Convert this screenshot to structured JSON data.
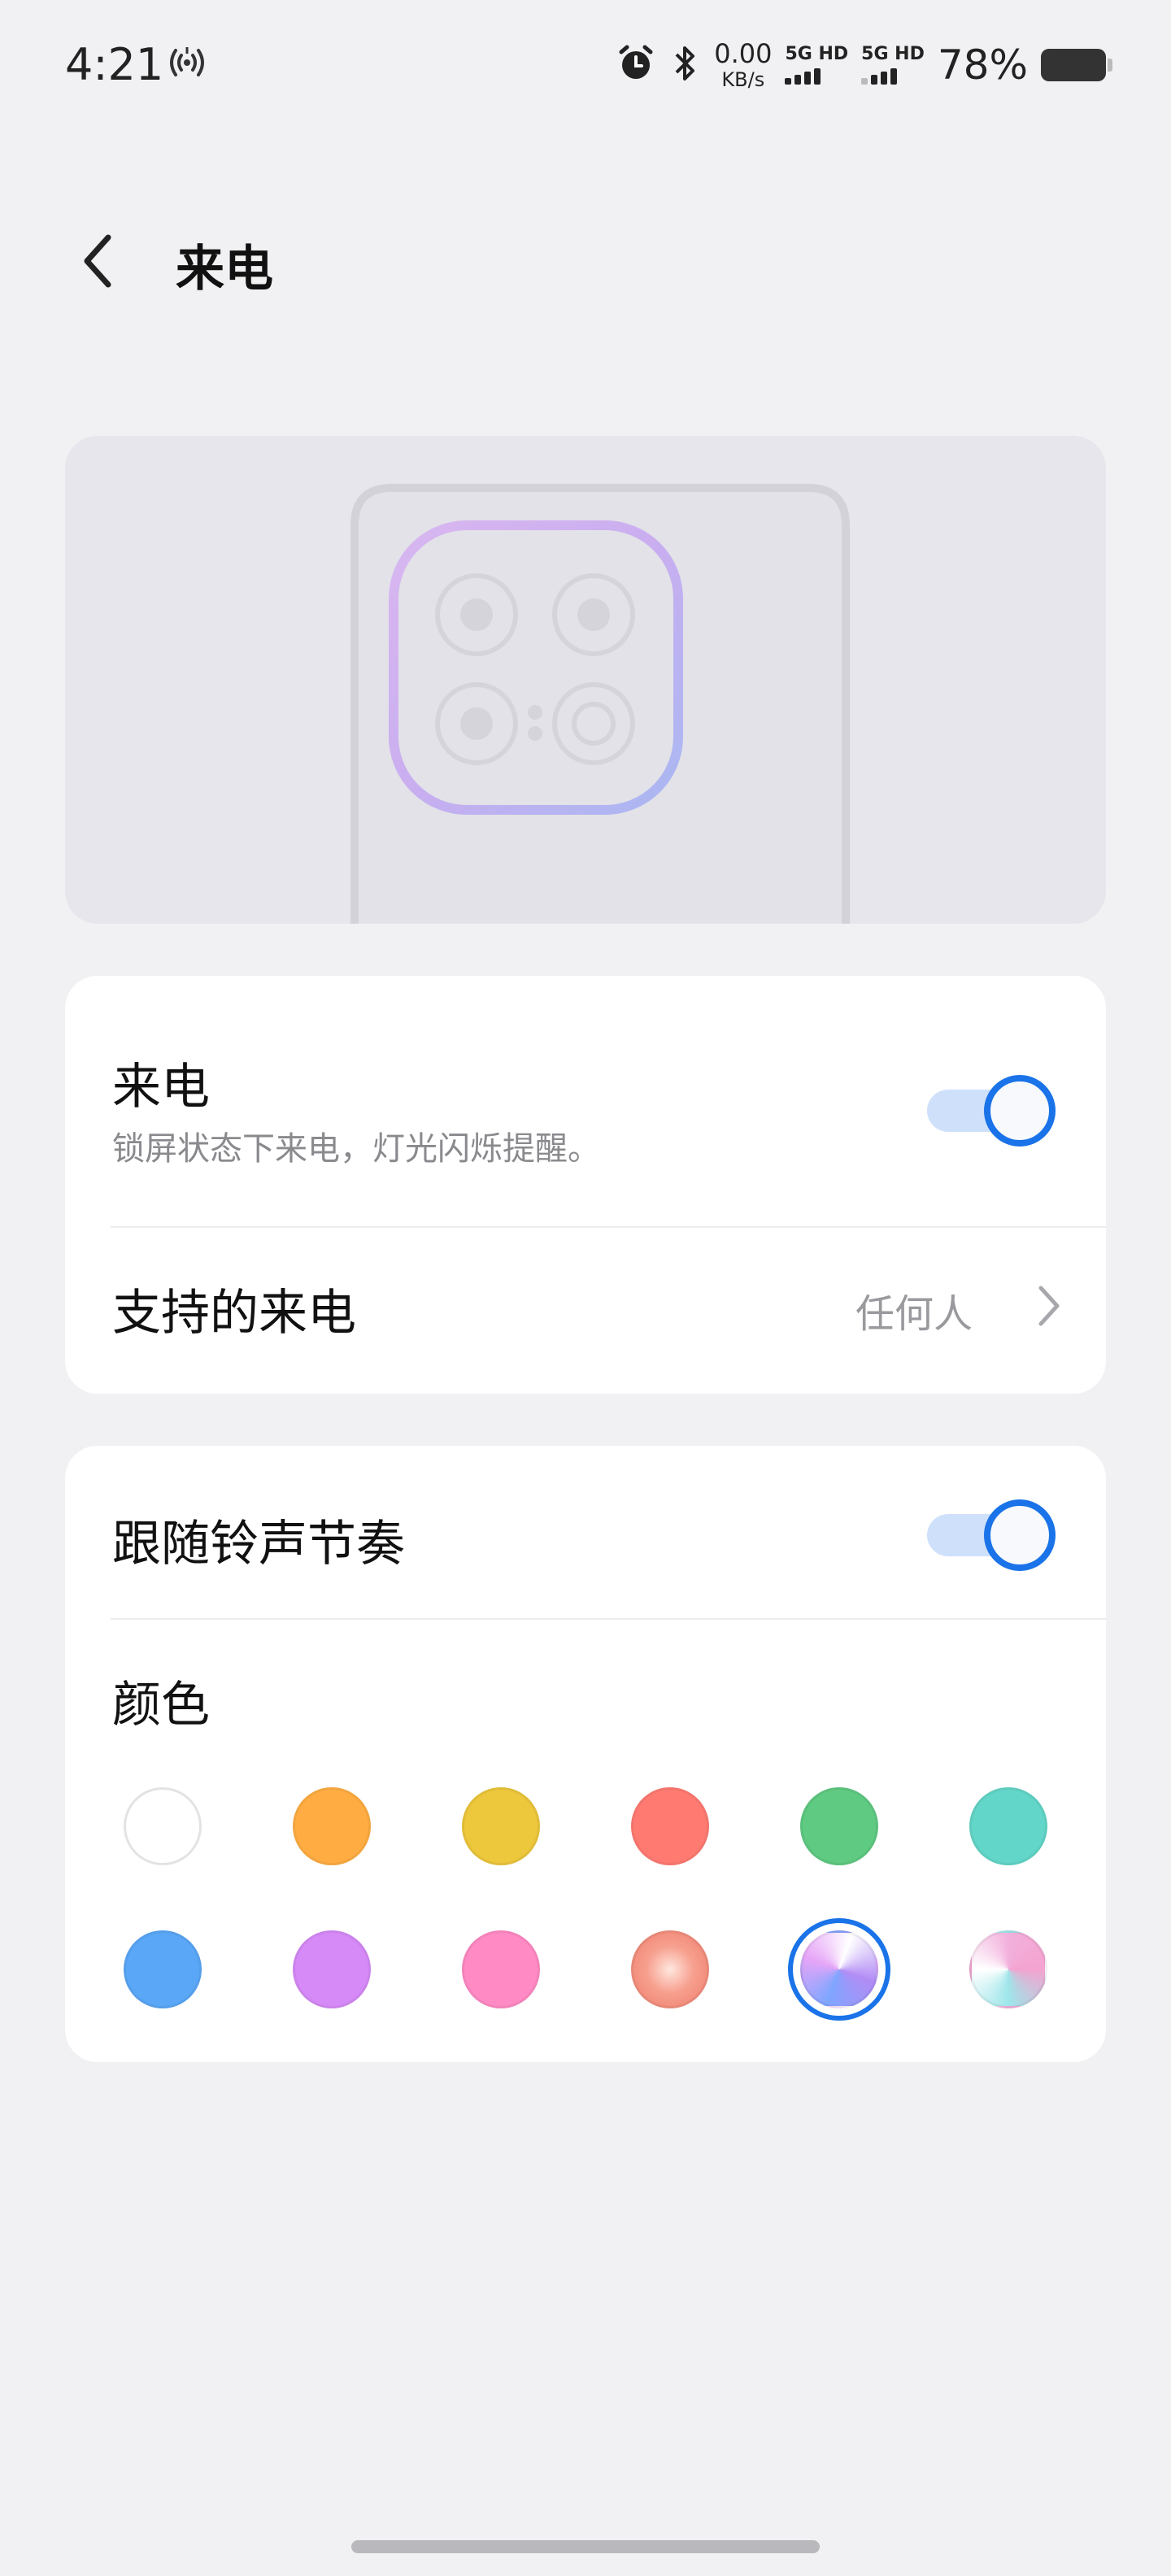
{
  "status_bar": {
    "time": "4:21",
    "net_speed_value": "0.00",
    "net_speed_unit": "KB/s",
    "sim1_label": "5G HD",
    "sim2_label": "5G HD",
    "battery_percent": "78%",
    "battery_level": 0.78
  },
  "header": {
    "title": "来电"
  },
  "incoming_call": {
    "title": "来电",
    "subtitle": "锁屏状态下来电，灯光闪烁提醒。",
    "enabled": true
  },
  "supported_calls": {
    "title": "支持的来电",
    "value": "任何人"
  },
  "follow_ringtone": {
    "title": "跟随铃声节奏",
    "enabled": true
  },
  "color_section": {
    "title": "颜色",
    "selected_index": 10,
    "swatches": [
      {
        "name": "white",
        "color": "#ffffff"
      },
      {
        "name": "orange",
        "color": "#ffad42"
      },
      {
        "name": "yellow",
        "color": "#edc73c"
      },
      {
        "name": "red",
        "color": "#ff7b72"
      },
      {
        "name": "green",
        "color": "#5fca82"
      },
      {
        "name": "teal",
        "color": "#62d6c8"
      },
      {
        "name": "blue",
        "color": "#5aa7f7"
      },
      {
        "name": "purple",
        "color": "#d68af7"
      },
      {
        "name": "pink",
        "color": "#ff8ac4"
      },
      {
        "name": "coral-gradient",
        "color": "#f49a8a"
      },
      {
        "name": "blue-purple-gradient",
        "color": "#b08af0"
      },
      {
        "name": "cyan-pink-gradient",
        "color": "#e6a8d8"
      }
    ]
  },
  "colors": {
    "accent": "#1a73e8",
    "page_bg": "#f1f1f4",
    "card_bg": "#ffffff"
  }
}
